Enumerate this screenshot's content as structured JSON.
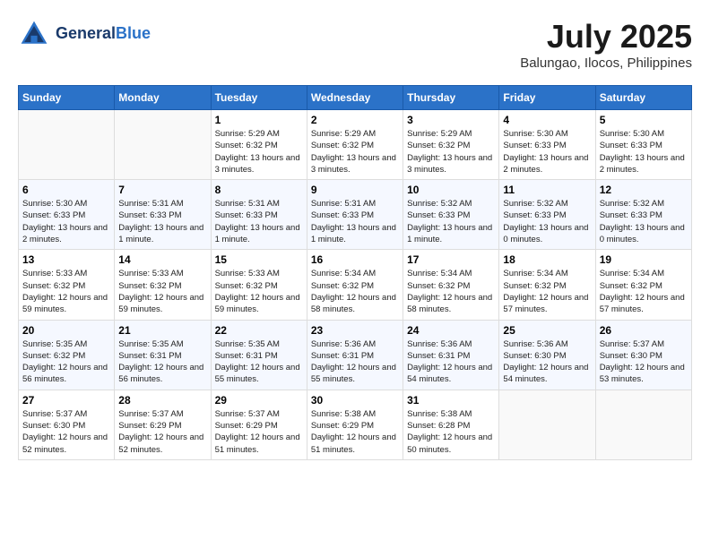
{
  "header": {
    "logo_line1": "General",
    "logo_line2": "Blue",
    "title": "July 2025",
    "subtitle": "Balungao, Ilocos, Philippines"
  },
  "weekdays": [
    "Sunday",
    "Monday",
    "Tuesday",
    "Wednesday",
    "Thursday",
    "Friday",
    "Saturday"
  ],
  "weeks": [
    [
      {
        "day": "",
        "info": ""
      },
      {
        "day": "",
        "info": ""
      },
      {
        "day": "1",
        "info": "Sunrise: 5:29 AM\nSunset: 6:32 PM\nDaylight: 13 hours and 3 minutes."
      },
      {
        "day": "2",
        "info": "Sunrise: 5:29 AM\nSunset: 6:32 PM\nDaylight: 13 hours and 3 minutes."
      },
      {
        "day": "3",
        "info": "Sunrise: 5:29 AM\nSunset: 6:32 PM\nDaylight: 13 hours and 3 minutes."
      },
      {
        "day": "4",
        "info": "Sunrise: 5:30 AM\nSunset: 6:33 PM\nDaylight: 13 hours and 2 minutes."
      },
      {
        "day": "5",
        "info": "Sunrise: 5:30 AM\nSunset: 6:33 PM\nDaylight: 13 hours and 2 minutes."
      }
    ],
    [
      {
        "day": "6",
        "info": "Sunrise: 5:30 AM\nSunset: 6:33 PM\nDaylight: 13 hours and 2 minutes."
      },
      {
        "day": "7",
        "info": "Sunrise: 5:31 AM\nSunset: 6:33 PM\nDaylight: 13 hours and 1 minute."
      },
      {
        "day": "8",
        "info": "Sunrise: 5:31 AM\nSunset: 6:33 PM\nDaylight: 13 hours and 1 minute."
      },
      {
        "day": "9",
        "info": "Sunrise: 5:31 AM\nSunset: 6:33 PM\nDaylight: 13 hours and 1 minute."
      },
      {
        "day": "10",
        "info": "Sunrise: 5:32 AM\nSunset: 6:33 PM\nDaylight: 13 hours and 1 minute."
      },
      {
        "day": "11",
        "info": "Sunrise: 5:32 AM\nSunset: 6:33 PM\nDaylight: 13 hours and 0 minutes."
      },
      {
        "day": "12",
        "info": "Sunrise: 5:32 AM\nSunset: 6:33 PM\nDaylight: 13 hours and 0 minutes."
      }
    ],
    [
      {
        "day": "13",
        "info": "Sunrise: 5:33 AM\nSunset: 6:32 PM\nDaylight: 12 hours and 59 minutes."
      },
      {
        "day": "14",
        "info": "Sunrise: 5:33 AM\nSunset: 6:32 PM\nDaylight: 12 hours and 59 minutes."
      },
      {
        "day": "15",
        "info": "Sunrise: 5:33 AM\nSunset: 6:32 PM\nDaylight: 12 hours and 59 minutes."
      },
      {
        "day": "16",
        "info": "Sunrise: 5:34 AM\nSunset: 6:32 PM\nDaylight: 12 hours and 58 minutes."
      },
      {
        "day": "17",
        "info": "Sunrise: 5:34 AM\nSunset: 6:32 PM\nDaylight: 12 hours and 58 minutes."
      },
      {
        "day": "18",
        "info": "Sunrise: 5:34 AM\nSunset: 6:32 PM\nDaylight: 12 hours and 57 minutes."
      },
      {
        "day": "19",
        "info": "Sunrise: 5:34 AM\nSunset: 6:32 PM\nDaylight: 12 hours and 57 minutes."
      }
    ],
    [
      {
        "day": "20",
        "info": "Sunrise: 5:35 AM\nSunset: 6:32 PM\nDaylight: 12 hours and 56 minutes."
      },
      {
        "day": "21",
        "info": "Sunrise: 5:35 AM\nSunset: 6:31 PM\nDaylight: 12 hours and 56 minutes."
      },
      {
        "day": "22",
        "info": "Sunrise: 5:35 AM\nSunset: 6:31 PM\nDaylight: 12 hours and 55 minutes."
      },
      {
        "day": "23",
        "info": "Sunrise: 5:36 AM\nSunset: 6:31 PM\nDaylight: 12 hours and 55 minutes."
      },
      {
        "day": "24",
        "info": "Sunrise: 5:36 AM\nSunset: 6:31 PM\nDaylight: 12 hours and 54 minutes."
      },
      {
        "day": "25",
        "info": "Sunrise: 5:36 AM\nSunset: 6:30 PM\nDaylight: 12 hours and 54 minutes."
      },
      {
        "day": "26",
        "info": "Sunrise: 5:37 AM\nSunset: 6:30 PM\nDaylight: 12 hours and 53 minutes."
      }
    ],
    [
      {
        "day": "27",
        "info": "Sunrise: 5:37 AM\nSunset: 6:30 PM\nDaylight: 12 hours and 52 minutes."
      },
      {
        "day": "28",
        "info": "Sunrise: 5:37 AM\nSunset: 6:29 PM\nDaylight: 12 hours and 52 minutes."
      },
      {
        "day": "29",
        "info": "Sunrise: 5:37 AM\nSunset: 6:29 PM\nDaylight: 12 hours and 51 minutes."
      },
      {
        "day": "30",
        "info": "Sunrise: 5:38 AM\nSunset: 6:29 PM\nDaylight: 12 hours and 51 minutes."
      },
      {
        "day": "31",
        "info": "Sunrise: 5:38 AM\nSunset: 6:28 PM\nDaylight: 12 hours and 50 minutes."
      },
      {
        "day": "",
        "info": ""
      },
      {
        "day": "",
        "info": ""
      }
    ]
  ]
}
